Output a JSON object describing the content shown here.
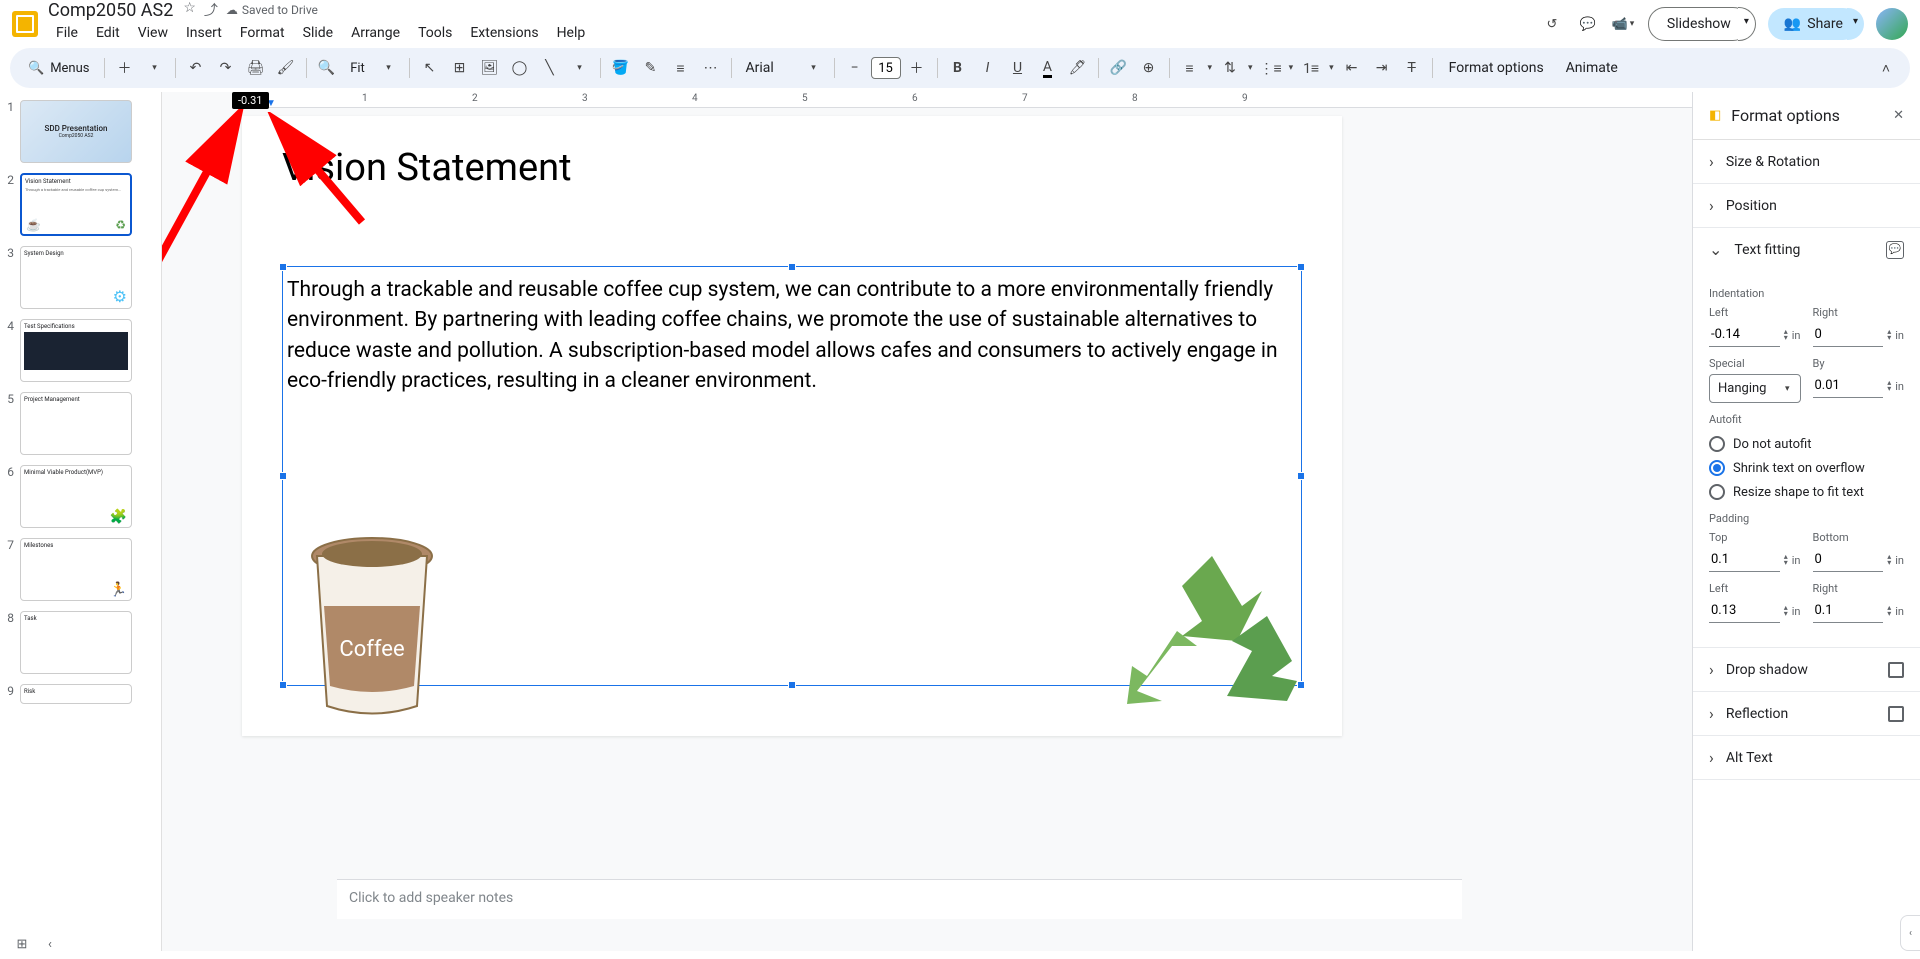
{
  "doc": {
    "title": "Comp2050 AS2",
    "saved": "Saved to Drive"
  },
  "header": {
    "slideshow": "Slideshow",
    "share": "Share"
  },
  "menubar": [
    "File",
    "Edit",
    "View",
    "Insert",
    "Format",
    "Slide",
    "Arrange",
    "Tools",
    "Extensions",
    "Help"
  ],
  "toolbar": {
    "menus": "Menus",
    "zoom": "Fit",
    "font": "Arial",
    "font_size": "15",
    "format_options": "Format options",
    "animate": "Animate"
  },
  "ruler_tooltip": "-0.31",
  "ruler_ticks": [
    "1",
    "2",
    "3",
    "4",
    "5",
    "6",
    "7",
    "8",
    "9"
  ],
  "slide_panel": {
    "slides": [
      {
        "num": "1",
        "title": "SDD Presentation",
        "sub": "Comp2050 AS2"
      },
      {
        "num": "2",
        "title": "Vision Statement"
      },
      {
        "num": "3",
        "title": "System Design"
      },
      {
        "num": "4",
        "title": "Test Specifications"
      },
      {
        "num": "5",
        "title": "Project Management"
      },
      {
        "num": "6",
        "title": "Minimal Viable Product(MVP)"
      },
      {
        "num": "7",
        "title": "Milestones"
      },
      {
        "num": "8",
        "title": "Task"
      },
      {
        "num": "9",
        "title": "Risk"
      }
    ]
  },
  "slide": {
    "title": "Vision Statement",
    "body": "Through a trackable and reusable coffee cup system, we can contribute to a more environmentally friendly environment. By partnering with leading coffee chains, we promote the use of sustainable alternatives to reduce waste and pollution. A subscription-based model allows cafes and consumers to actively engage in eco-friendly practices, resulting in a cleaner environment."
  },
  "speaker_notes_placeholder": "Click to add speaker notes",
  "sidebar": {
    "title": "Format options",
    "sections": {
      "size_rotation": "Size & Rotation",
      "position": "Position",
      "text_fitting": "Text fitting",
      "drop_shadow": "Drop shadow",
      "reflection": "Reflection",
      "alt_text": "Alt Text"
    },
    "indentation": {
      "header": "Indentation",
      "left_label": "Left",
      "left_value": "-0.14",
      "right_label": "Right",
      "right_value": "0",
      "special_label": "Special",
      "special_value": "Hanging",
      "by_label": "By",
      "by_value": "0.01",
      "unit": "in"
    },
    "autofit": {
      "header": "Autofit",
      "opt1": "Do not autofit",
      "opt2": "Shrink text on overflow",
      "opt3": "Resize shape to fit text"
    },
    "padding": {
      "header": "Padding",
      "top_label": "Top",
      "top_value": "0.1",
      "bottom_label": "Bottom",
      "bottom_value": "0",
      "left_label": "Left",
      "left_value": "0.13",
      "right_label": "Right",
      "right_value": "0.1",
      "unit": "in"
    }
  }
}
